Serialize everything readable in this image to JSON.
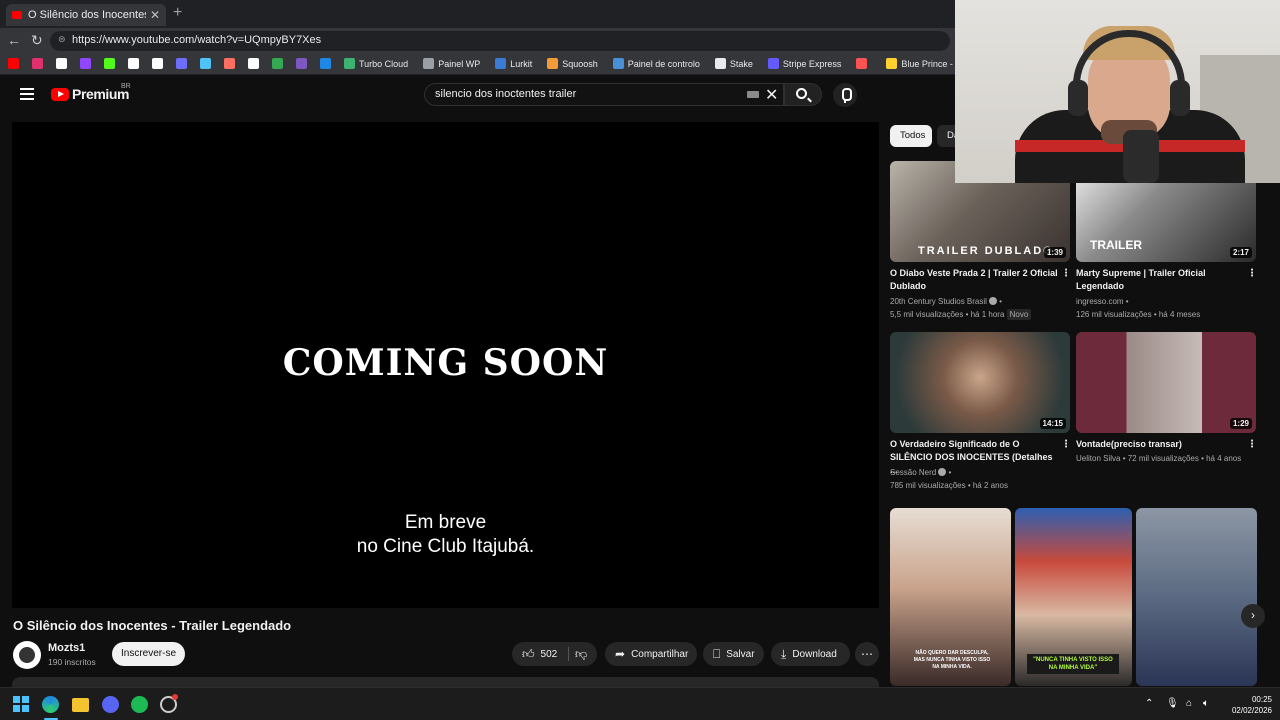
{
  "browser": {
    "tab_title": "O Silêncio dos Inocentes - Trailer L",
    "tab_close": "✕",
    "new_tab": "+",
    "url": "https://www.youtube.com/watch?v=UQmpyBY7Xes",
    "bookmarks": [
      {
        "label": "Turbo Cloud",
        "color": "#3cb371"
      },
      {
        "label": "Painel WP",
        "color": "#9aa0a6"
      },
      {
        "label": "Lurkit",
        "color": "#3a7bd5"
      },
      {
        "label": "Squoosh",
        "color": "#f29b38"
      },
      {
        "label": "Painel de controlo",
        "color": "#4a90d9"
      },
      {
        "label": "Stake",
        "color": "#e8eaed"
      },
      {
        "label": "Stripe Express",
        "color": "#635bff"
      },
      {
        "label": "",
        "color": "#ff5252"
      },
      {
        "label": "Blue Prince - Miro",
        "color": "#ffd02f"
      }
    ],
    "icon_only_bookmark_colors": [
      "#ff0000",
      "#e1306c",
      "#ffffff",
      "#9146ff",
      "#53fc18",
      "#ffffff",
      "#ffffff",
      "#6d6dff",
      "#4fc3f7",
      "#ff6f61",
      "#ffffff",
      "#34a853",
      "#7e57c2",
      "#1e88e5"
    ]
  },
  "youtube": {
    "logo_text": "Premium",
    "region": "BR",
    "search_query": "silencio dos inoctentes trailer",
    "clear": "✕",
    "player": {
      "headline": "COMING SOON",
      "subtitle_line1": "Em breve",
      "subtitle_line2": "no Cine Club Itajubá."
    },
    "video_title": "O Silêncio dos Inocentes - Trailer Legendado",
    "channel": {
      "name": "Mozts1",
      "subscribers": "190 inscritos",
      "subscribe_label": "Inscrever-se"
    },
    "actions": {
      "likes": "502",
      "share": "Compartilhar",
      "save": "Salvar",
      "download": "Download",
      "more": "⋯"
    },
    "chips": {
      "active": "Todos",
      "other": "Da"
    },
    "recommendations": [
      {
        "title": "O Diabo Veste Prada 2 | Trailer 2 Oficial Dublado",
        "channel": "20th Century Studios Brasil",
        "meta": "5,5 mil visualizações • há 1 hora",
        "badge": "Novo",
        "duration": "1:39",
        "overlay": "TRAILER DUBLADO"
      },
      {
        "title": "Marty Supreme | Trailer Oficial Legendado",
        "channel": "ingresso.com",
        "meta": "126 mil visualizações • há 4 meses",
        "duration": "2:17",
        "overlay": "TRAILER"
      },
      {
        "title": "O Verdadeiro Significado de O SILÊNCIO DOS INOCENTES (Detalhes ...",
        "channel": "Sessão Nerd",
        "meta": "785 mil visualizações • há 2 anos",
        "duration": "14:15"
      },
      {
        "title": "Vontade(preciso transar)",
        "meta": "Ueliton Silva • 72 mil visualizações • há 4 anos",
        "duration": "1:29"
      }
    ],
    "shorts": [
      {
        "caption": "NÃO QUERO DAR DESCULPA, MAS NUNCA TINHA VISTO ISSO NA MINHA VIDA."
      },
      {
        "caption": "\"NUNCA TINHA VISTO ISSO NA MINHA VIDA\""
      },
      {
        "caption": ""
      }
    ],
    "next_arrow": "›"
  },
  "taskbar": {
    "time": "00:25",
    "date": "02/02/2026"
  }
}
